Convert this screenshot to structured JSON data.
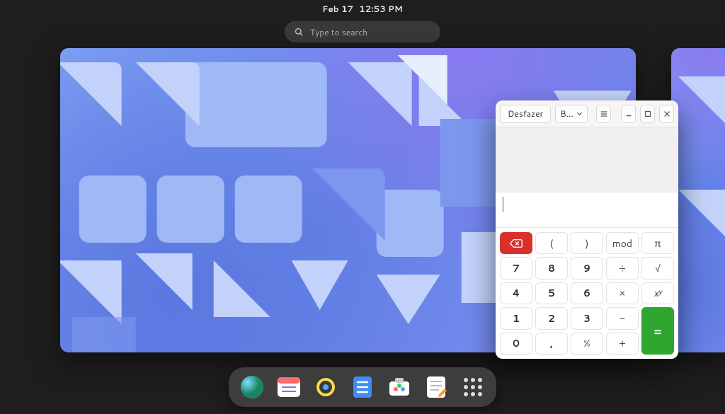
{
  "topbar": {
    "date": "Feb 17",
    "time": "12:53 PM"
  },
  "search": {
    "placeholder": "Type to search"
  },
  "calculator": {
    "header": {
      "undo": "Desfazer",
      "mode_short": "B…"
    },
    "keys": {
      "lparen": "(",
      "rparen": ")",
      "mod": "mod",
      "pi": "π",
      "7": "7",
      "8": "8",
      "9": "9",
      "div": "÷",
      "sqrt": "√",
      "4": "4",
      "5": "5",
      "6": "6",
      "mul": "×",
      "pow": "xʸ",
      "1": "1",
      "2": "2",
      "3": "3",
      "sub": "−",
      "eq": "=",
      "0": "0",
      "dot": ",",
      "pct": "%",
      "add": "+"
    }
  },
  "dock": {
    "apps": [
      {
        "name": "web-browser"
      },
      {
        "name": "calendar"
      },
      {
        "name": "music"
      },
      {
        "name": "todo"
      },
      {
        "name": "software"
      },
      {
        "name": "text-editor"
      },
      {
        "name": "app-grid"
      }
    ]
  }
}
